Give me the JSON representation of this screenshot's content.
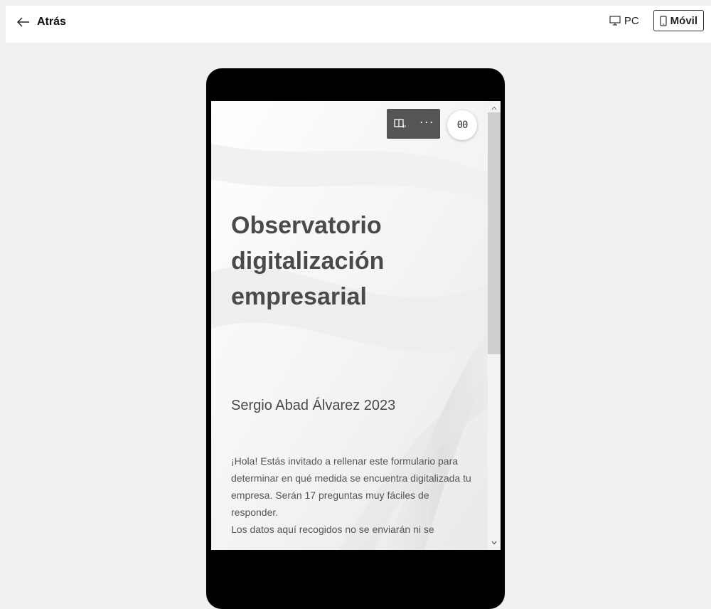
{
  "header": {
    "back_label": "Atrás",
    "view_options": [
      {
        "label": "PC",
        "icon": "monitor-icon",
        "active": false
      },
      {
        "label": "Móvil",
        "icon": "phone-icon",
        "active": true
      }
    ]
  },
  "preview": {
    "toolbar": {
      "immersive_reader_icon": "immersive-reader-icon",
      "more_icon": "more-options-icon"
    },
    "pause_icon": "pause-icon",
    "pause_glyph": "00",
    "form": {
      "title": "Observatorio digitalización empresarial",
      "author": "Sergio Abad Álvarez 2023",
      "intro_lines": [
        "¡Hola! Estás invitado a rellenar este formulario para determinar en qué medida se encuentra digitalizada tu empresa. Serán 17 preguntas muy fáciles de responder.",
        "Los datos aquí recogidos no se enviarán ni se"
      ]
    }
  },
  "colors": {
    "page_background": "#f0f0f0",
    "device_frame": "#000000",
    "title_text": "#4a4a4a",
    "toolbar_background": "#555555"
  }
}
